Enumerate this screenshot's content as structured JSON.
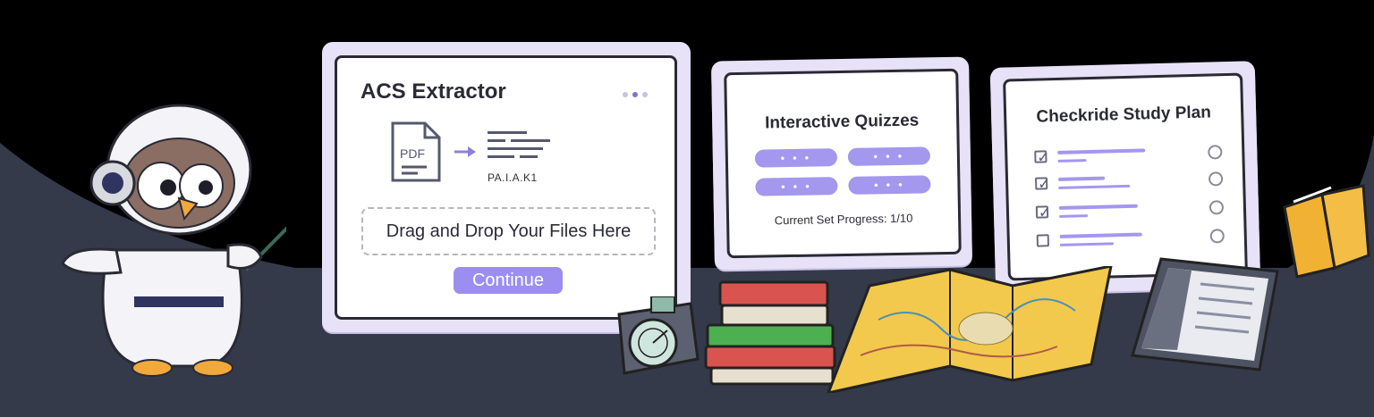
{
  "acs_extractor": {
    "title": "ACS Extractor",
    "pdf_label": "PDF",
    "code_label": "PA.I.A.K1",
    "dropzone_text": "Drag and Drop Your Files Here",
    "continue_label": "Continue"
  },
  "quizzes": {
    "title": "Interactive Quizzes",
    "pills": [
      "• • •",
      "• • •",
      "• • •",
      "• • •"
    ],
    "progress_text": "Current Set Progress: 1/10"
  },
  "study_plan": {
    "title": "Checkride Study Plan",
    "items": [
      {
        "checked": true,
        "done": false
      },
      {
        "checked": true,
        "done": false
      },
      {
        "checked": true,
        "done": false
      },
      {
        "checked": false,
        "done": false
      }
    ]
  },
  "colors": {
    "background": "#343a4a",
    "card_frame": "#e7e2f7",
    "accent": "#9b8ef0",
    "map_yellow": "#f2c94c",
    "book_red": "#d9534f",
    "book_green": "#4caf50"
  },
  "icons": [
    "owl-mascot",
    "pointer-stick",
    "pdf-icon",
    "arrow-right-icon",
    "text-lines-icon",
    "flight-computer-icon",
    "books-icon",
    "sectional-map-icon",
    "tablet-icon",
    "open-book-icon"
  ]
}
